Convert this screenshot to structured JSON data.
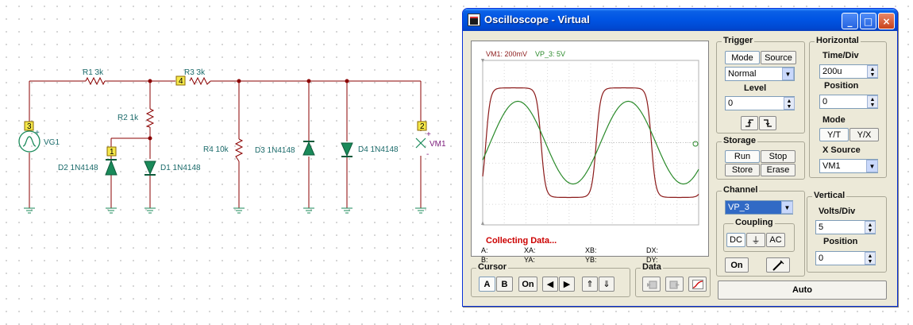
{
  "schematic": {
    "labels": {
      "r1": "R1 3k",
      "r3": "R3 3k",
      "r2": "R2 1k",
      "r4": "R4 10k",
      "d1": "D1 1N4148",
      "d2": "D2 1N4148",
      "d3": "D3 1N4148",
      "d4": "D4 1N4148",
      "vg1": "VG1",
      "vm1": "VM1",
      "node3": "3",
      "node4": "4",
      "node1": "1",
      "node2": "2",
      "plus": "+",
      "minus": "-"
    }
  },
  "window": {
    "title": "Oscilloscope - Virtual",
    "controls": {
      "minimize": "_",
      "maximize": "□",
      "close": "×"
    }
  },
  "screen": {
    "channel_labels": {
      "vm1": "VM1: 200mV",
      "vp3": "VP_3: 5V"
    },
    "status": "Collecting Data...",
    "readouts": {
      "a": "A:",
      "b": "B:",
      "xa": "XA:",
      "ya": "YA:",
      "xb": "XB:",
      "yb": "YB:",
      "dx": "DX:",
      "dy": "DY:"
    },
    "trace_colors": {
      "vm1": "#8b1a1a",
      "vp3": "#2a8a2a"
    }
  },
  "trigger": {
    "title": "Trigger",
    "mode_button": "Mode",
    "source_button": "Source",
    "mode_value": "Normal",
    "level_label": "Level",
    "level_value": "0",
    "rising_edge_icon": "rising-edge-icon",
    "falling_edge_icon": "falling-edge-icon"
  },
  "horizontal": {
    "title": "Horizontal",
    "time_div_label": "Time/Div",
    "time_div_value": "200u",
    "position_label": "Position",
    "position_value": "0",
    "mode_label": "Mode",
    "yt_button": "Y/T",
    "yx_button": "Y/X",
    "xsource_label": "X Source",
    "xsource_value": "VM1"
  },
  "storage": {
    "title": "Storage",
    "run": "Run",
    "stop": "Stop",
    "store": "Store",
    "erase": "Erase"
  },
  "channel": {
    "title": "Channel",
    "selected": "VP_3",
    "coupling_label": "Coupling",
    "dc": "DC",
    "gnd": "⏚",
    "ac": "AC",
    "on_button": "On",
    "probe_icon": "probe-icon"
  },
  "vertical": {
    "title": "Vertical",
    "volts_div_label": "Volts/Div",
    "volts_div_value": "5",
    "position_label": "Position",
    "position_value": "0"
  },
  "cursor": {
    "title": "Cursor",
    "a": "A",
    "b": "B",
    "on": "On",
    "left": "◀",
    "right": "▶",
    "up": "⇑",
    "down": "⇓"
  },
  "data": {
    "title": "Data"
  },
  "auto_button": "Auto"
}
